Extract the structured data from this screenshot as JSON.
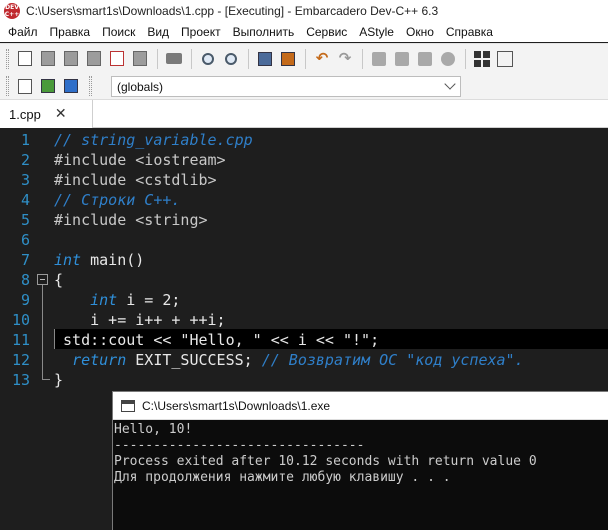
{
  "window": {
    "title": "C:\\Users\\smart1s\\Downloads\\1.cpp - [Executing] - Embarcadero Dev-C++ 6.3",
    "app_icon_text": "DEV C++"
  },
  "menu": [
    "Файл",
    "Правка",
    "Поиск",
    "Вид",
    "Проект",
    "Выполнить",
    "Сервис",
    "AStyle",
    "Окно",
    "Справка"
  ],
  "toolbar": {
    "scope_value": "(globals)"
  },
  "tab": {
    "label": "1.cpp",
    "close_glyph": "✕"
  },
  "editor": {
    "lines": [
      {
        "n": "1",
        "segments": [
          {
            "t": "// string_variable.cpp",
            "c": "comment"
          }
        ]
      },
      {
        "n": "2",
        "segments": [
          {
            "t": "#include <iostream>",
            "c": "pre"
          }
        ]
      },
      {
        "n": "3",
        "segments": [
          {
            "t": "#include <cstdlib>",
            "c": "pre"
          }
        ]
      },
      {
        "n": "4",
        "segments": [
          {
            "t": "// Строки С++.",
            "c": "comment"
          }
        ]
      },
      {
        "n": "5",
        "segments": [
          {
            "t": "#include <string>",
            "c": "pre"
          }
        ]
      },
      {
        "n": "6",
        "segments": []
      },
      {
        "n": "7",
        "segments": [
          {
            "t": "int",
            "c": "kw"
          },
          {
            "t": " main()",
            "c": "plain"
          }
        ]
      },
      {
        "n": "8",
        "segments": [
          {
            "t": "{",
            "c": "plain"
          }
        ]
      },
      {
        "n": "9",
        "segments": [
          {
            "t": "    ",
            "c": "plain"
          },
          {
            "t": "int",
            "c": "kw"
          },
          {
            "t": " i = 2;",
            "c": "plain"
          }
        ]
      },
      {
        "n": "10",
        "segments": [
          {
            "t": "    i += i++ + ++i;",
            "c": "plain"
          }
        ]
      },
      {
        "n": "11",
        "segments": [
          {
            "t": " std::cout << \"Hello, \" << i << \"!\";",
            "c": "plain"
          }
        ]
      },
      {
        "n": "12",
        "segments": [
          {
            "t": "  ",
            "c": "plain"
          },
          {
            "t": "return",
            "c": "kw"
          },
          {
            "t": " EXIT_SUCCESS; ",
            "c": "plain"
          },
          {
            "t": "// Возвратим ОС \"код успеха\".",
            "c": "comment"
          }
        ]
      },
      {
        "n": "13",
        "segments": [
          {
            "t": "}",
            "c": "plain"
          }
        ]
      }
    ]
  },
  "console": {
    "title": "C:\\Users\\smart1s\\Downloads\\1.exe",
    "output": "Hello, 10!\n--------------------------------\nProcess exited after 10.12 seconds with return value 0\nДля продолжения нажмите любую клавишу . . ."
  }
}
